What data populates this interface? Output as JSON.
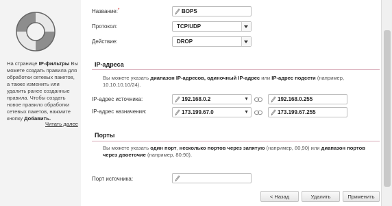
{
  "sidebar": {
    "help_prefix": "На странице ",
    "help_bold": "IP-фильтры",
    "help_text": " Вы можете создать правила для обработки сетевых пакетов, а также изменить или удалить ранее созданные правила. Чтобы создать новое правило обработки сетевых пакетов, нажмите кнопку ",
    "help_bold2": "Добавить.",
    "read_more": "Читать далее"
  },
  "form": {
    "name_label": "Название:",
    "name_required": "*",
    "name_value": "BOPS",
    "protocol_label": "Протокол:",
    "protocol_value": "TCP/UDP",
    "action_label": "Действие:",
    "action_value": "DROP"
  },
  "ip_section": {
    "title": "IP-адреса",
    "desc_prefix": "Вы можете указать ",
    "desc_bold1": "диапазон IP-адресов, одиночный IP-адрес",
    "desc_mid": " или ",
    "desc_bold2": "IP-адрес подсети",
    "desc_suffix": " (например, 10.10.10.10/24).",
    "src_label": "IP-адрес источника:",
    "src_from": "192.168.0.2",
    "src_to": "192.168.0.255",
    "dst_label": "IP-адрес назначения:",
    "dst_from": "173.199.67.0",
    "dst_to": "173.199.67.255"
  },
  "ports_section": {
    "title": "Порты",
    "desc_prefix": "Вы можете указать ",
    "desc_bold1": "один порт",
    "desc_mid1": ", ",
    "desc_bold2": "несколько портов через запятую",
    "desc_mid2": " (например, 80,90) или ",
    "desc_bold3": "диапазон портов через двоеточие",
    "desc_suffix": " (например, 80:90).",
    "src_port_label": "Порт источника:",
    "src_port_value": ""
  },
  "buttons": {
    "back": "< Назад",
    "apply": "Удалить",
    "save": "Применить"
  },
  "colors": {
    "accent_line": "#d7a9b7",
    "lifebuoy": "#9a9a9a"
  }
}
